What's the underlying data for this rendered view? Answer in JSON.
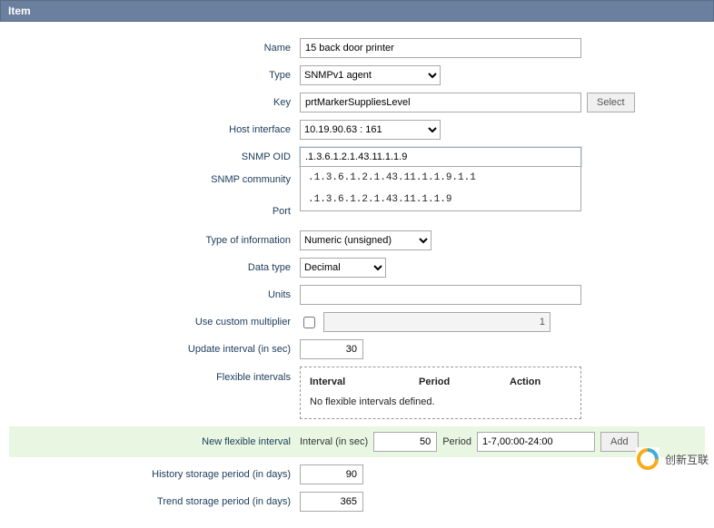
{
  "panel": {
    "title": "Item"
  },
  "labels": {
    "name": "Name",
    "type": "Type",
    "key": "Key",
    "host_interface": "Host interface",
    "snmp_oid": "SNMP OID",
    "snmp_community": "SNMP community",
    "port": "Port",
    "type_of_information": "Type of information",
    "data_type": "Data type",
    "units": "Units",
    "use_custom_multiplier": "Use custom multiplier",
    "update_interval": "Update interval (in sec)",
    "flexible_intervals": "Flexible intervals",
    "new_flexible_interval": "New flexible interval",
    "history_storage": "History storage period (in days)",
    "trend_storage": "Trend storage period (in days)"
  },
  "values": {
    "name": "15 back door printer",
    "type": "SNMPv1 agent",
    "key": "prtMarkerSuppliesLevel",
    "host_interface": "10.19.90.63 : 161",
    "snmp_oid": ".1.3.6.1.2.1.43.11.1.1.9",
    "snmp_community": "",
    "port": "",
    "type_of_information": "Numeric (unsigned)",
    "data_type": "Decimal",
    "units": "",
    "multiplier": "1",
    "update_interval": "30",
    "new_interval_sec": "50",
    "new_interval_period": "1-7,00:00-24:00",
    "history_days": "90",
    "trend_days": "365"
  },
  "buttons": {
    "select": "Select",
    "add": "Add"
  },
  "suggestions": [
    ".1.3.6.1.2.1.43.11.1.1.9.1.1",
    ".1.3.6.1.2.1.43.11.1.1.9"
  ],
  "flex_table": {
    "col_interval": "Interval",
    "col_period": "Period",
    "col_action": "Action",
    "empty_msg": "No flexible intervals defined."
  },
  "new_flex": {
    "interval_label": "Interval (in sec)",
    "period_label": "Period"
  },
  "watermark": {
    "text": "创新互联"
  }
}
